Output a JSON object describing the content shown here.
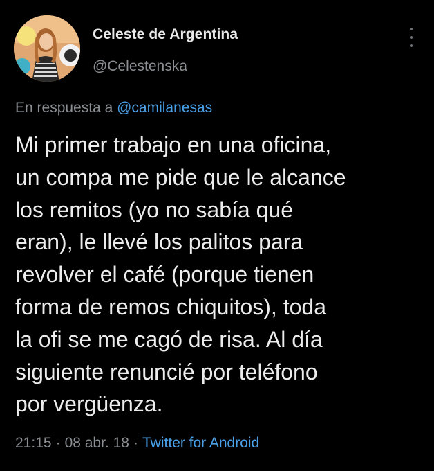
{
  "user": {
    "display_name": "Celeste de Argentina",
    "handle": "@Celestenska"
  },
  "header": {
    "more_icon": "more-vertical-icon"
  },
  "reply": {
    "prefix": "En respuesta a",
    "mention": "@camilanesas"
  },
  "tweet": {
    "lines": [
      "Mi primer trabajo en una oficina,",
      "un compa me pide que le alcance",
      "los remitos (yo no sabía qué",
      "eran), le llevé los palitos para",
      "revolver el café (porque tienen",
      "forma de remos chiquitos), toda",
      "la ofi se me cagó de risa. Al día",
      "siguiente renuncié por teléfono",
      "por vergüenza."
    ]
  },
  "meta": {
    "time": "21:15",
    "date": "08 abr. 18",
    "separator": "·",
    "source": "Twitter for Android"
  },
  "colors": {
    "background": "#000000",
    "text": "#ececec",
    "muted": "#8b8f93",
    "link": "#4aa0e8"
  }
}
